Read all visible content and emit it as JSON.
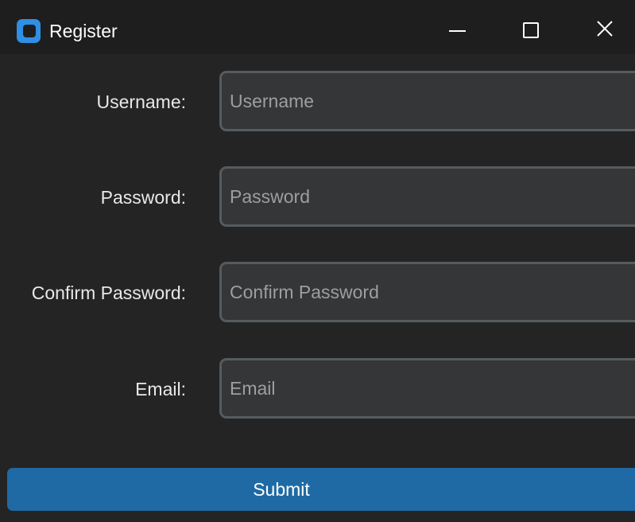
{
  "window": {
    "title": "Register",
    "app_icon": "app-logo-icon",
    "controls": [
      "minimize-icon",
      "maximize-icon",
      "close-icon"
    ]
  },
  "form": {
    "fields": [
      {
        "label": "Username:",
        "placeholder": "Username",
        "value": ""
      },
      {
        "label": "Password:",
        "placeholder": "Password",
        "value": ""
      },
      {
        "label": "Confirm Password:",
        "placeholder": "Confirm Password",
        "value": ""
      },
      {
        "label": "Email:",
        "placeholder": "Email",
        "value": ""
      }
    ],
    "submit_label": "Submit"
  },
  "colors": {
    "background": "#242424",
    "titlebar": "#1e1e1e",
    "field_background": "#343638",
    "field_border": "#565b5e",
    "accent": "#1f6aa5",
    "app_icon": "#2f8fe4"
  }
}
